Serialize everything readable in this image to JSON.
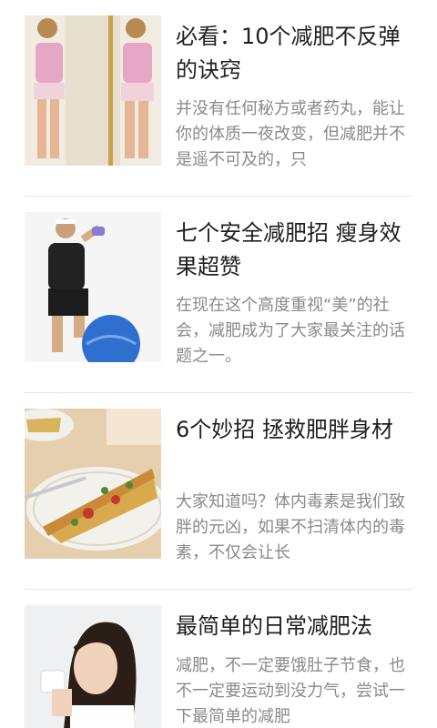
{
  "articles": [
    {
      "title": "必看：10个减肥不反弹的诀窍",
      "summary": "并没有任何秘方或者药丸，能让你的体质一夜改变，但减肥并不是遥不可及的，只"
    },
    {
      "title": "七个安全减肥招 瘦身效果超赞",
      "summary": "在现在这个高度重视“美”的社会，减肥成为了大家最关注的话题之一。"
    },
    {
      "title": "6个妙招 拯救肥胖身材",
      "summary": "大家知道吗？体内毒素是我们致胖的元凶，如果不扫清体内的毒素，不仅会让长"
    },
    {
      "title": "最简单的日常减肥法",
      "summary": "减肥，不一定要饿肚子节食，也不一定要运动到没力气，尝试一下最简单的减肥"
    }
  ]
}
